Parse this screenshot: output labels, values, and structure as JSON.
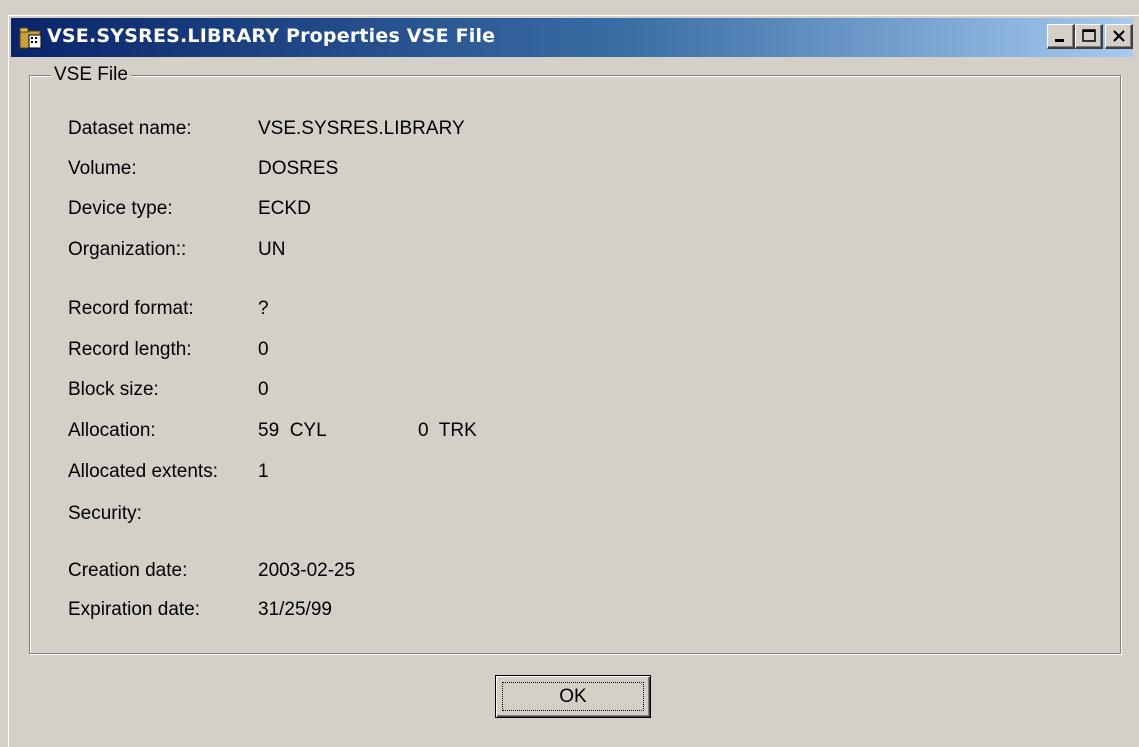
{
  "window": {
    "title": "VSE.SYSRES.LIBRARY Properties VSE File",
    "icon": "file-properties-icon",
    "titlebar_colors": [
      "#0a246a",
      "#a6caf0"
    ]
  },
  "group": {
    "legend": "VSE File"
  },
  "fields": {
    "dataset_name": {
      "label": "Dataset name:",
      "value": "VSE.SYSRES.LIBRARY"
    },
    "volume": {
      "label": "Volume:",
      "value": "DOSRES"
    },
    "device_type": {
      "label": "Device type:",
      "value": "ECKD"
    },
    "organization": {
      "label": "Organization::",
      "value": "UN"
    },
    "record_format": {
      "label": "Record format:",
      "value": "?"
    },
    "record_length": {
      "label": "Record length:",
      "value": "0"
    },
    "block_size": {
      "label": "Block size:",
      "value": "0"
    },
    "allocation": {
      "label": "Allocation:",
      "value": "59  CYL",
      "value2": "0  TRK"
    },
    "allocated_extents": {
      "label": "Allocated extents:",
      "value": "1"
    },
    "security": {
      "label": "Security:",
      "value": ""
    },
    "creation_date": {
      "label": "Creation date:",
      "value": "2003-02-25"
    },
    "expiration_date": {
      "label": "Expiration date:",
      "value": "31/25/99"
    }
  },
  "buttons": {
    "ok_label": "OK"
  }
}
